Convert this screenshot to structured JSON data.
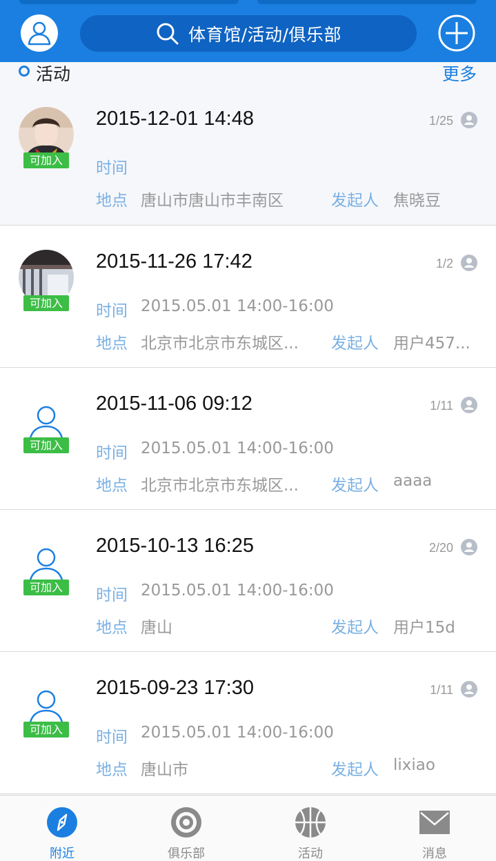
{
  "header": {
    "search_text": "体育馆/活动/俱乐部"
  },
  "section": {
    "title": "活动",
    "more": "更多"
  },
  "labels": {
    "time": "时间",
    "place": "地点",
    "organizer": "发起人",
    "joinable": "可加入"
  },
  "activities": [
    {
      "date": "2015-12-01 14:48",
      "count": "1/25",
      "time": "",
      "place": "唐山市唐山市丰南区",
      "organizer": "焦晓豆",
      "avatar": "photo-girl"
    },
    {
      "date": "2015-11-26 17:42",
      "count": "1/2",
      "time": "2015.05.01 14:00-16:00",
      "place": "北京市北京市东城区...",
      "organizer": "用户457...",
      "avatar": "photo-building"
    },
    {
      "date": "2015-11-06 09:12",
      "count": "1/11",
      "time": "2015.05.01 14:00-16:00",
      "place": "北京市北京市东城区...",
      "organizer": "aaaa",
      "avatar": "default-person"
    },
    {
      "date": "2015-10-13 16:25",
      "count": "2/20",
      "time": "2015.05.01 14:00-16:00",
      "place": "唐山",
      "organizer": "用户15d",
      "avatar": "default-person"
    },
    {
      "date": "2015-09-23 17:30",
      "count": "1/11",
      "time": "2015.05.01 14:00-16:00",
      "place": "唐山市",
      "organizer": "lixiao",
      "avatar": "default-person"
    }
  ],
  "tabs": [
    {
      "label": "附近",
      "icon": "compass-icon",
      "active": true
    },
    {
      "label": "俱乐部",
      "icon": "target-icon",
      "active": false
    },
    {
      "label": "活动",
      "icon": "basketball-icon",
      "active": false
    },
    {
      "label": "消息",
      "icon": "mail-icon",
      "active": false
    }
  ],
  "colors": {
    "brand_blue": "#1a7fe0",
    "badge_green": "#3cbd46",
    "label_blue": "#7ab0e3"
  }
}
